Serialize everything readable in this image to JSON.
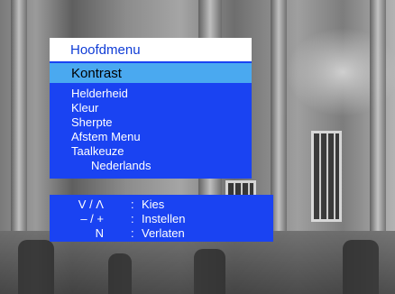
{
  "menu": {
    "title": "Hoofdmenu",
    "selected": "Kontrast",
    "items": [
      "Helderheid",
      "Kleur",
      "Sherpte",
      "Afstem Menu",
      "Taalkeuze"
    ],
    "language_value": "Nederlands"
  },
  "help": {
    "rows": [
      {
        "key": "V / Λ",
        "sep": ":",
        "text": "Kies"
      },
      {
        "key": "– / +",
        "sep": ":",
        "text": "Instellen"
      },
      {
        "key": "N",
        "sep": ":",
        "text": "Verlaten"
      }
    ]
  },
  "colors": {
    "menu_blue": "#1a43f2",
    "selection_cyan": "#4aa9f0",
    "title_bg": "#ffffff",
    "title_text": "#0f3cd6"
  }
}
